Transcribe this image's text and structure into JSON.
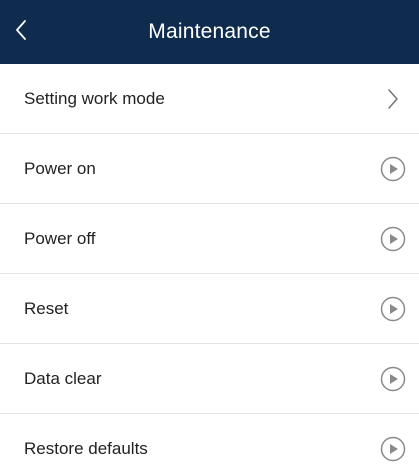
{
  "header": {
    "title": "Maintenance",
    "back_icon": "chevron-left-icon",
    "background": "#0f2c4f"
  },
  "items": [
    {
      "label": "Setting work mode",
      "icon": "chevron-right-icon"
    },
    {
      "label": "Power on",
      "icon": "play-circle-icon"
    },
    {
      "label": "Power off",
      "icon": "play-circle-icon"
    },
    {
      "label": "Reset",
      "icon": "play-circle-icon"
    },
    {
      "label": "Data clear",
      "icon": "play-circle-icon"
    },
    {
      "label": "Restore defaults",
      "icon": "play-circle-icon"
    }
  ]
}
